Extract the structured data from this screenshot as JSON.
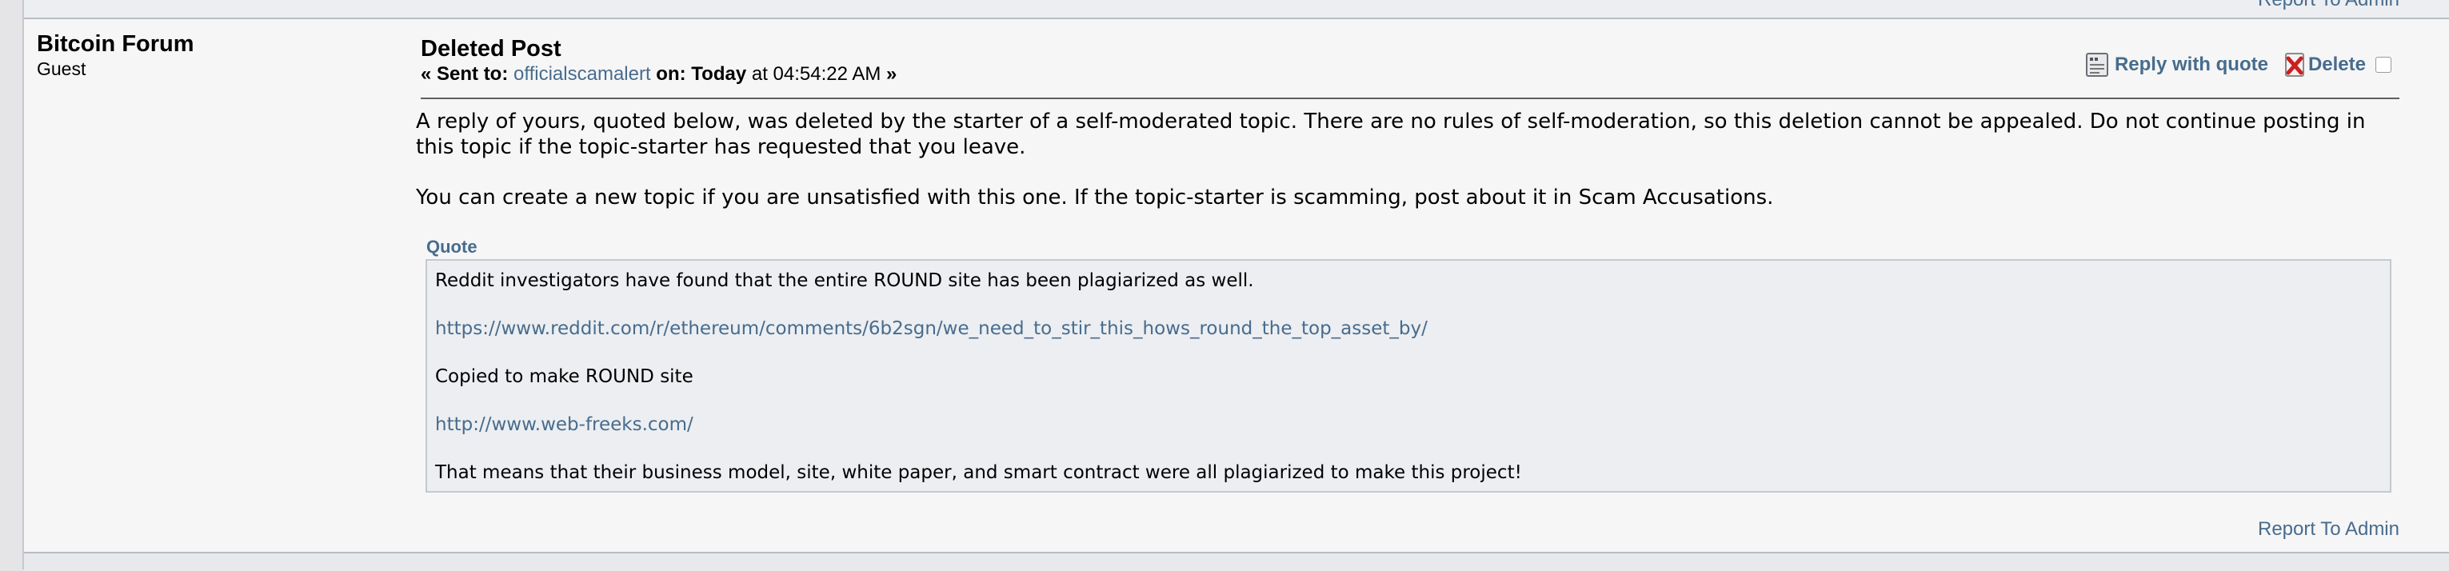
{
  "header": {
    "top_report_label": "Report To Admin"
  },
  "poster": {
    "name": "Bitcoin Forum",
    "rank": "Guest"
  },
  "post": {
    "subject": "Deleted Post",
    "sent_prefix": "« Sent to: ",
    "recipient": "officialscamalert",
    "on_label": " on: ",
    "date_word": "Today",
    "time_text": " at 04:54:22 AM",
    "sent_suffix": " »",
    "actions": {
      "reply_with_quote": "Reply with quote",
      "delete": "Delete",
      "quote_icon": "reply-quote-icon",
      "delete_icon": "delete-x-icon"
    },
    "paragraph_1": "A reply of yours, quoted below, was deleted by the starter of a self-moderated topic. There are no rules of self-moderation, so this deletion cannot be appealed. Do not continue posting in this topic if the topic-starter has requested that you leave.",
    "paragraph_2": "You can create a new topic if you are unsatisfied with this one. If the topic-starter is scamming, post about it in Scam Accusations.",
    "quote": {
      "header": "Quote",
      "line_1": "Reddit investigators have found that the entire ROUND site has been plagiarized as well.",
      "link_1": "https://www.reddit.com/r/ethereum/comments/6b2sgn/we_need_to_stir_this_hows_round_the_top_asset_by/",
      "line_2": "Copied to make ROUND site",
      "link_2": "http://www.web-freeks.com/",
      "line_3": "That means that their business model, site, white paper, and smart contract were all plagiarized to make this project!"
    },
    "report_label": "Report To Admin"
  },
  "colors": {
    "link": "#476c8e",
    "page_bg": "#f6f6f6",
    "quote_bg": "#eceef1",
    "delete_red": "#cc1f1f"
  }
}
